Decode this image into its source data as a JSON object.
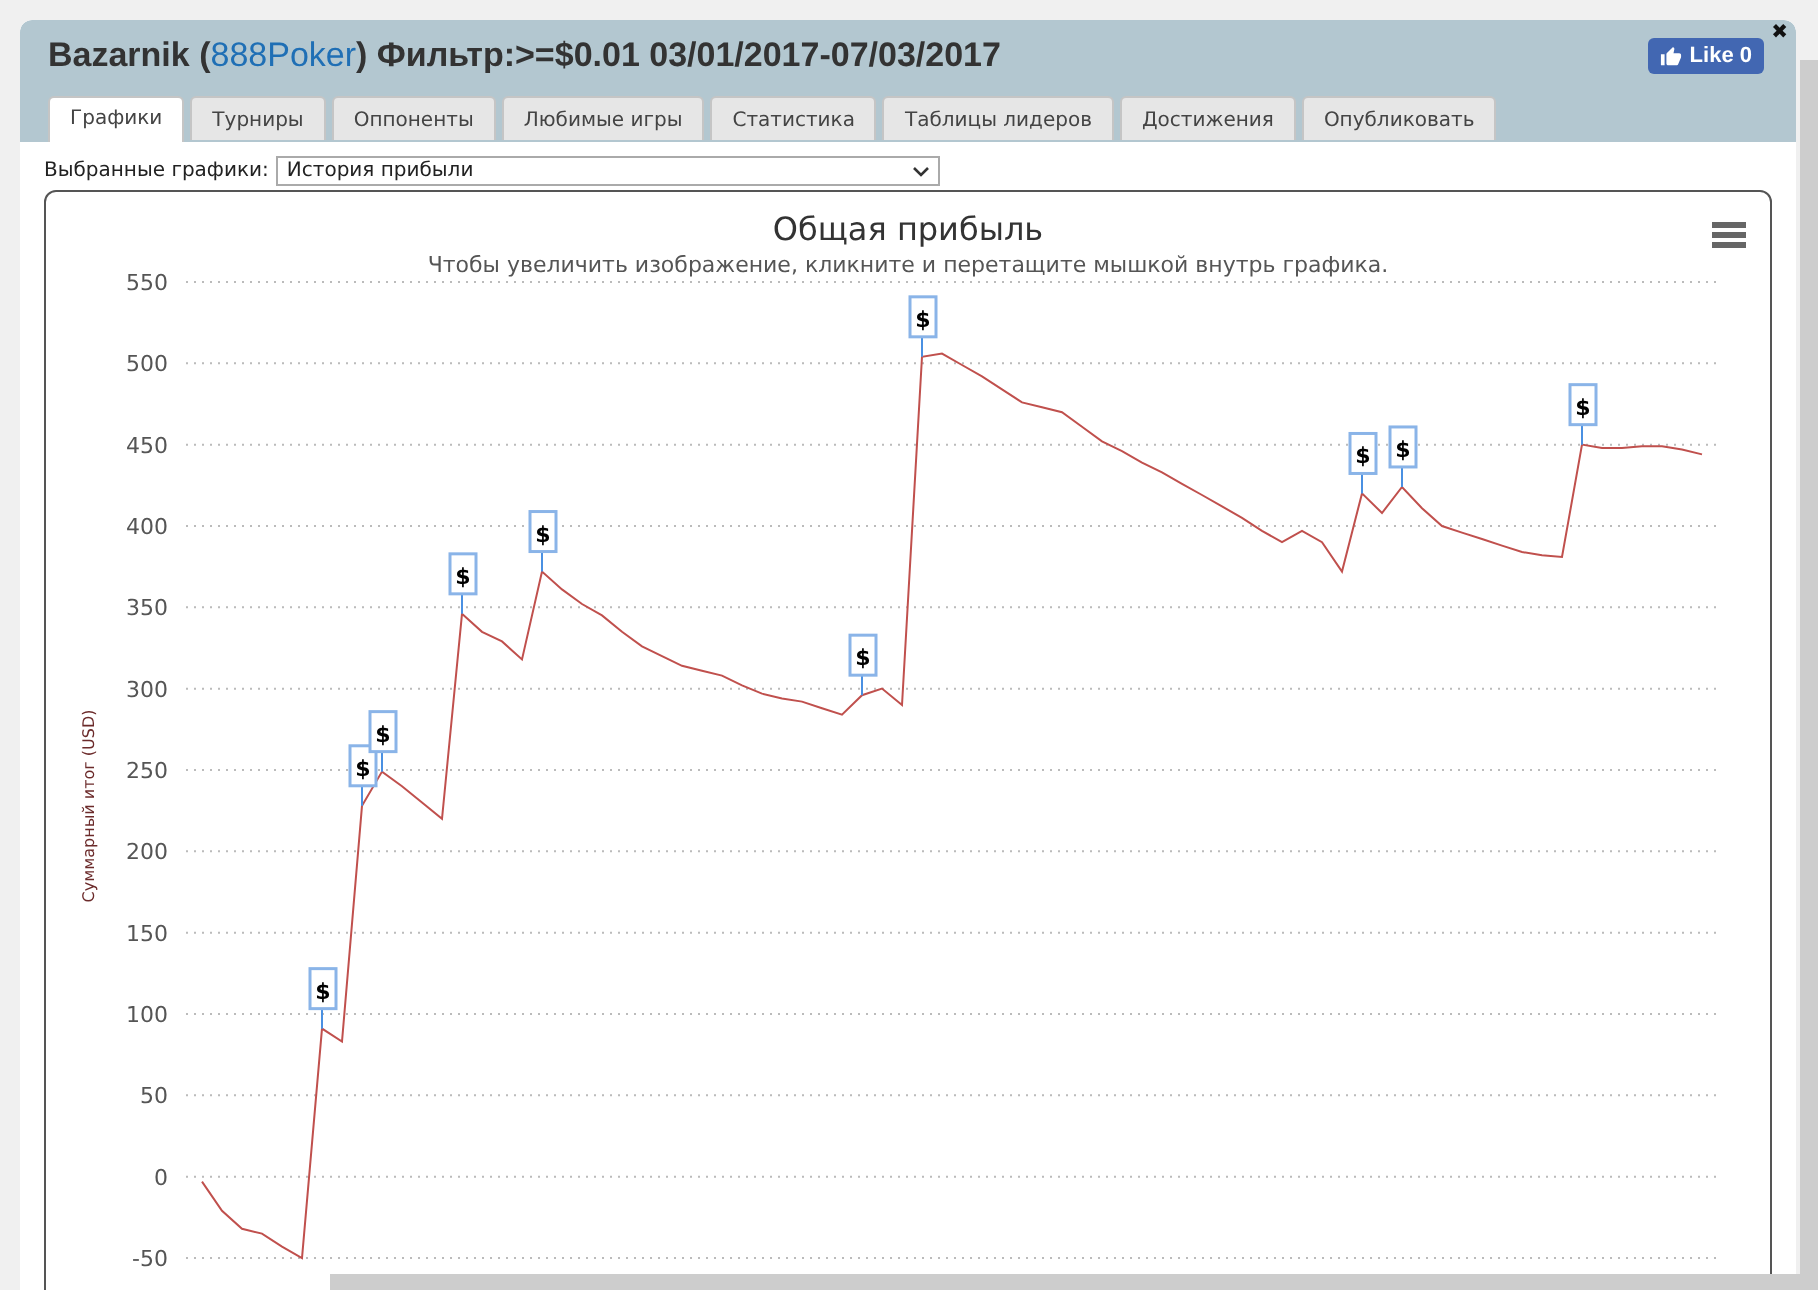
{
  "window": {
    "title_before": "Bazarnik (",
    "title_site": "888Poker",
    "title_after": ") Фильтр:>=$0.01 03/01/2017-07/03/2017",
    "close": "✖",
    "like": {
      "label": "Like",
      "count": "0"
    }
  },
  "tabs": [
    {
      "label": "Графики",
      "selected": true
    },
    {
      "label": "Турниры",
      "selected": false
    },
    {
      "label": "Оппоненты",
      "selected": false
    },
    {
      "label": "Любимые игры",
      "selected": false
    },
    {
      "label": "Статистика",
      "selected": false
    },
    {
      "label": "Таблицы лидеров",
      "selected": false
    },
    {
      "label": "Достижения",
      "selected": false
    },
    {
      "label": "Опубликовать",
      "selected": false
    }
  ],
  "chart_select": {
    "label": "Выбранные графики:",
    "value": "История прибыли"
  },
  "chart": {
    "chart_data": {
      "type": "line",
      "title": "Общая прибыль",
      "subtitle": "Чтобы увеличить изображение, кликните и перетащите мышкой внутрь графика.",
      "ylabel": "Суммарный итог (USD)",
      "ylim": [
        -50,
        550
      ],
      "yticks": [
        {
          "value": -50,
          "label": "-50"
        },
        {
          "value": 0,
          "label": "0"
        },
        {
          "value": 50,
          "label": "50"
        },
        {
          "value": 100,
          "label": "100"
        },
        {
          "value": 150,
          "label": "150"
        },
        {
          "value": 200,
          "label": "200"
        },
        {
          "value": 250,
          "label": "250"
        },
        {
          "value": 300,
          "label": "300"
        },
        {
          "value": 350,
          "label": "350"
        },
        {
          "value": 400,
          "label": "400"
        },
        {
          "value": 450,
          "label": "450"
        },
        {
          "value": 500,
          "label": "500"
        },
        {
          "value": 550,
          "label": "550"
        }
      ],
      "categories": [
        null,
        null,
        null,
        null,
        null,
        null,
        null,
        null,
        null,
        null,
        null,
        null,
        null,
        null,
        null,
        null,
        null,
        null,
        null,
        null,
        null,
        null,
        null,
        null,
        null,
        null,
        null,
        null,
        null,
        null,
        null,
        null,
        null,
        null,
        null,
        null,
        null,
        null,
        null,
        null,
        null,
        null,
        null,
        null,
        null,
        null,
        null,
        null,
        null,
        null,
        null,
        null,
        null,
        null,
        null,
        null,
        null,
        null,
        null,
        null,
        null,
        null,
        null,
        null,
        null,
        null,
        null,
        null,
        null,
        null,
        null,
        null,
        null,
        null,
        null,
        null
      ],
      "series": [
        {
          "color": "#c0504d",
          "values": [
            -3,
            -21,
            -32,
            -35,
            -43,
            -50,
            91,
            83,
            228,
            249,
            240,
            230,
            220,
            346,
            335,
            329,
            318,
            372,
            361,
            352,
            345,
            335,
            326,
            320,
            314,
            311,
            308,
            302,
            297,
            294,
            292,
            288,
            284,
            296,
            300,
            290,
            504,
            506,
            499,
            492,
            484,
            476,
            473,
            470,
            461,
            452,
            446,
            439,
            433,
            426,
            419,
            412,
            405,
            397,
            390,
            397,
            390,
            372,
            420,
            408,
            424,
            411,
            400,
            396,
            392,
            388,
            384,
            382,
            381,
            450,
            448,
            448,
            449,
            449,
            447,
            444
          ]
        }
      ],
      "grid": true,
      "annotations": [
        {
          "y": 91,
          "text": "$"
        },
        {
          "y": 228,
          "text": "$"
        },
        {
          "y": 249,
          "text": "$"
        },
        {
          "y": 346,
          "text": "$"
        },
        {
          "y": 372,
          "text": "$"
        },
        {
          "y": 296,
          "text": "$"
        },
        {
          "y": 504,
          "text": "$"
        },
        {
          "y": 420,
          "text": "$"
        },
        {
          "y": 424,
          "text": "$"
        },
        {
          "y": 450,
          "text": "$"
        }
      ]
    }
  }
}
